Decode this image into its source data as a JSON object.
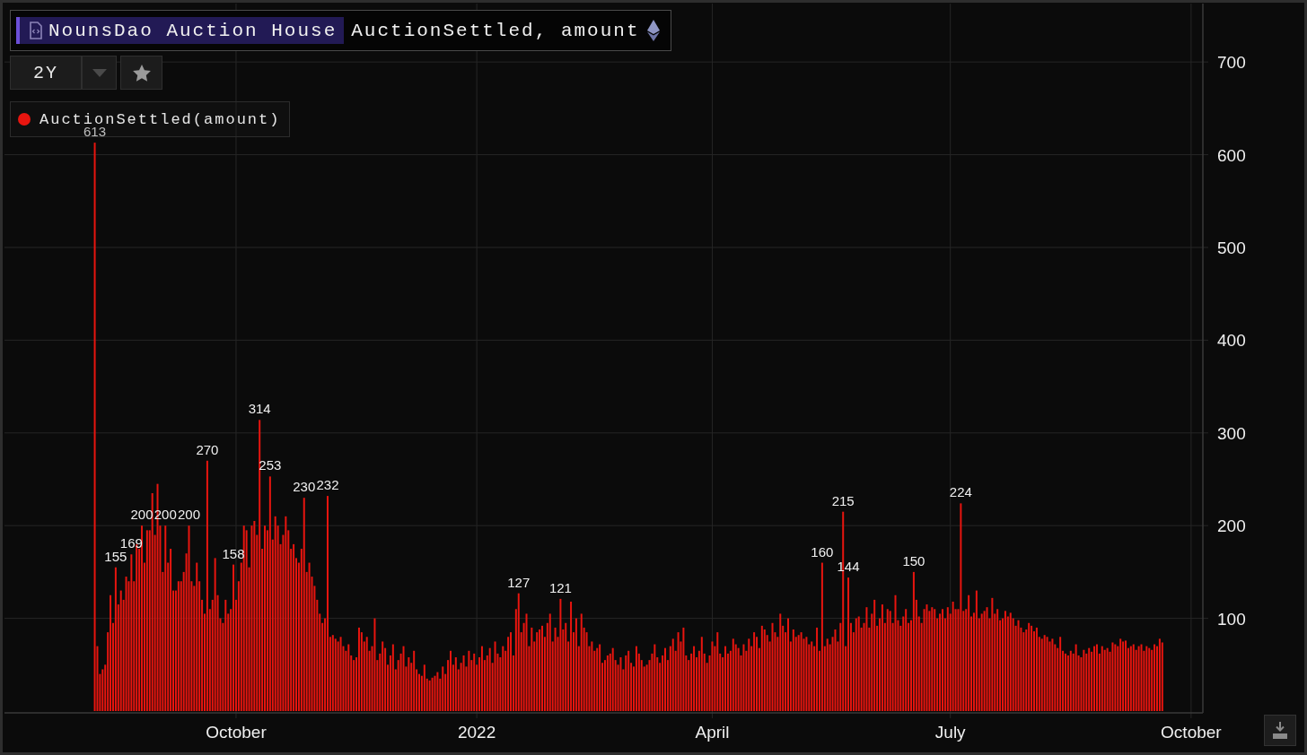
{
  "header": {
    "source": "NounsDao Auction House",
    "series_label": "AuctionSettled, amount"
  },
  "range": {
    "label": "2Y"
  },
  "chart_data": {
    "type": "bar",
    "grid": true,
    "ylim": [
      0,
      763
    ],
    "categories": [
      null,
      null,
      null,
      null,
      null,
      null,
      null,
      null,
      null,
      null,
      null,
      null,
      null,
      null,
      null,
      null,
      null,
      null,
      null,
      null,
      null,
      null,
      null,
      null,
      null,
      null,
      null,
      null,
      null,
      null,
      null,
      null,
      null,
      null,
      null,
      null,
      null,
      null,
      null,
      null,
      null,
      null,
      null,
      null,
      null,
      null,
      null,
      null,
      null,
      null,
      null,
      null,
      null,
      null,
      null,
      null,
      null,
      null,
      null,
      null,
      null,
      null,
      null,
      null,
      null,
      null,
      null,
      null,
      null,
      null,
      null,
      null,
      null,
      null,
      null,
      null,
      null,
      null,
      null,
      null,
      null,
      null,
      null,
      null,
      null,
      null,
      null,
      null,
      "October",
      null,
      null,
      null,
      null,
      null,
      null,
      null,
      null,
      null,
      null,
      null,
      null,
      null,
      null,
      null,
      null,
      null,
      null,
      null,
      null,
      null,
      null,
      null,
      null,
      null,
      null,
      null,
      null,
      null,
      null,
      null,
      null,
      null,
      null,
      null,
      null,
      null,
      null,
      null,
      null,
      null,
      null,
      null,
      null,
      null,
      null,
      null,
      null,
      null,
      null,
      null,
      null,
      null,
      null,
      null,
      null,
      null,
      null,
      null,
      null,
      null,
      null,
      null,
      null,
      null,
      null,
      null,
      null,
      null,
      null,
      null,
      null,
      null,
      null,
      null,
      null,
      null,
      null,
      null,
      null,
      null,
      null,
      null,
      null,
      null,
      null,
      null,
      null,
      null,
      null,
      null,
      "2022",
      null,
      null,
      null,
      null,
      null,
      null,
      null,
      null,
      null,
      null,
      null,
      null,
      null,
      null,
      null,
      null,
      null,
      null,
      null,
      null,
      null,
      null,
      null,
      null,
      null,
      null,
      null,
      null,
      null,
      null,
      null,
      null,
      null,
      null,
      null,
      null,
      null,
      null,
      null,
      null,
      null,
      null,
      null,
      null,
      null,
      null,
      null,
      null,
      null,
      null,
      null,
      null,
      null,
      null,
      null,
      null,
      null,
      null,
      null,
      null,
      null,
      null,
      null,
      null,
      null,
      null,
      null,
      null,
      null,
      null,
      null,
      null,
      null,
      null,
      null,
      null,
      null,
      null,
      null,
      null,
      null,
      null,
      null,
      null,
      null,
      null,
      null,
      null,
      null,
      "April",
      null,
      null,
      null,
      null,
      null,
      null,
      null,
      null,
      null,
      null,
      null,
      null,
      null,
      null,
      null,
      null,
      null,
      null,
      null,
      null,
      null,
      null,
      null,
      null,
      null,
      null,
      null,
      null,
      null,
      null,
      null,
      null,
      null,
      null,
      null,
      null,
      null,
      null,
      null,
      null,
      null,
      null,
      null,
      null,
      null,
      null,
      null,
      null,
      null,
      null,
      null,
      null,
      null,
      null,
      null,
      null,
      null,
      null,
      null,
      null,
      null,
      null,
      null,
      null,
      null,
      null,
      null,
      null,
      null,
      null,
      null,
      null,
      null,
      null,
      null,
      null,
      null,
      null,
      null,
      null,
      null,
      null,
      null,
      null,
      null,
      null,
      null,
      null,
      null,
      null,
      "July",
      null,
      null,
      null,
      null,
      null,
      null,
      null,
      null,
      null,
      null,
      null,
      null,
      null,
      null,
      null,
      null,
      null,
      null,
      null,
      null,
      null,
      null,
      null,
      null,
      null,
      null,
      null,
      null,
      null,
      null,
      null,
      null,
      null,
      null,
      null,
      null,
      null,
      null,
      null,
      null,
      null,
      null,
      null,
      null,
      null,
      null,
      null,
      null,
      null,
      null,
      null,
      null,
      null,
      null,
      null,
      null,
      null,
      null,
      null,
      null,
      null,
      null,
      null,
      null,
      null,
      null,
      null,
      null,
      null,
      null,
      null,
      null,
      null,
      null,
      null,
      null,
      null,
      null,
      null,
      null,
      null,
      null,
      null,
      null,
      null,
      null,
      null,
      null,
      null,
      null,
      null,
      "October",
      null,
      null,
      null,
      null
    ],
    "yticks": [
      100,
      200,
      300,
      400,
      500,
      600,
      700
    ],
    "series": [
      {
        "name": "AuctionSettled(amount)",
        "color": "#e8150f",
        "values": [
          null,
          null,
          null,
          null,
          null,
          null,
          null,
          null,
          null,
          null,
          null,
          null,
          null,
          null,
          null,
          null,
          null,
          null,
          null,
          null,
          null,
          null,
          null,
          null,
          null,
          null,
          null,
          null,
          null,
          null,
          null,
          null,
          null,
          null,
          613,
          70,
          40,
          45,
          50,
          85,
          125,
          95,
          155,
          115,
          130,
          120,
          145,
          140,
          169,
          140,
          180,
          175,
          200,
          160,
          195,
          195,
          235,
          190,
          245,
          200,
          150,
          200,
          160,
          175,
          130,
          130,
          140,
          140,
          150,
          170,
          200,
          140,
          135,
          160,
          140,
          120,
          105,
          270,
          110,
          120,
          165,
          125,
          100,
          95,
          120,
          105,
          110,
          158,
          120,
          140,
          160,
          200,
          195,
          155,
          200,
          205,
          190,
          314,
          175,
          200,
          195,
          253,
          185,
          210,
          200,
          180,
          190,
          210,
          195,
          175,
          180,
          165,
          160,
          175,
          230,
          150,
          160,
          145,
          135,
          120,
          105,
          95,
          100,
          232,
          80,
          82,
          78,
          75,
          80,
          70,
          65,
          72,
          60,
          55,
          58,
          90,
          85,
          75,
          80,
          65,
          70,
          100,
          55,
          62,
          75,
          68,
          50,
          60,
          72,
          45,
          55,
          62,
          70,
          48,
          58,
          52,
          65,
          45,
          40,
          38,
          50,
          35,
          33,
          36,
          38,
          42,
          35,
          48,
          40,
          55,
          65,
          50,
          58,
          45,
          52,
          60,
          48,
          65,
          55,
          62,
          50,
          58,
          70,
          55,
          60,
          68,
          52,
          75,
          62,
          58,
          70,
          65,
          80,
          85,
          60,
          110,
          127,
          85,
          95,
          105,
          70,
          90,
          75,
          85,
          88,
          92,
          80,
          95,
          105,
          75,
          90,
          80,
          121,
          88,
          95,
          75,
          118,
          85,
          100,
          70,
          105,
          90,
          85,
          70,
          75,
          65,
          68,
          72,
          52,
          55,
          60,
          62,
          68,
          55,
          50,
          58,
          45,
          60,
          65,
          52,
          48,
          70,
          62,
          55,
          48,
          50,
          55,
          62,
          72,
          58,
          52,
          60,
          68,
          55,
          70,
          78,
          65,
          85,
          75,
          90,
          60,
          55,
          62,
          70,
          58,
          65,
          80,
          62,
          52,
          60,
          75,
          70,
          85,
          62,
          58,
          70,
          62,
          65,
          78,
          72,
          68,
          60,
          72,
          65,
          78,
          70,
          85,
          80,
          68,
          92,
          88,
          82,
          75,
          95,
          85,
          80,
          105,
          92,
          85,
          100,
          75,
          88,
          80,
          82,
          85,
          78,
          80,
          72,
          75,
          70,
          90,
          65,
          160,
          70,
          78,
          72,
          80,
          88,
          75,
          95,
          215,
          70,
          144,
          95,
          85,
          100,
          102,
          90,
          95,
          112,
          90,
          105,
          120,
          92,
          100,
          115,
          95,
          110,
          108,
          95,
          125,
          98,
          92,
          102,
          110,
          95,
          98,
          150,
          120,
          102,
          95,
          110,
          115,
          108,
          112,
          110,
          100,
          105,
          110,
          100,
          112,
          105,
          118,
          110,
          110,
          224,
          108,
          110,
          125,
          102,
          106,
          130,
          100,
          105,
          108,
          112,
          100,
          122,
          105,
          110,
          98,
          100,
          108,
          102,
          106,
          100,
          92,
          98,
          90,
          85,
          88,
          95,
          92,
          86,
          90,
          80,
          78,
          82,
          80,
          75,
          78,
          72,
          68,
          80,
          65,
          62,
          60,
          65,
          62,
          72,
          60,
          58,
          66,
          62,
          68,
          64,
          70,
          72,
          62,
          70,
          66,
          68,
          64,
          74,
          72,
          70,
          78,
          75,
          76,
          68,
          70,
          72,
          66,
          70,
          72,
          65,
          70,
          68,
          66,
          72,
          70,
          78,
          74,
          null,
          null,
          null,
          null,
          null,
          null,
          null,
          null,
          null,
          null,
          null,
          null,
          null,
          null,
          null
        ]
      }
    ],
    "value_labels": [
      null,
      null,
      null,
      null,
      null,
      null,
      null,
      null,
      null,
      null,
      null,
      null,
      null,
      null,
      null,
      null,
      null,
      null,
      null,
      null,
      null,
      null,
      null,
      null,
      null,
      null,
      null,
      null,
      null,
      null,
      null,
      null,
      null,
      null,
      "613",
      null,
      null,
      null,
      null,
      null,
      null,
      null,
      "155",
      null,
      null,
      null,
      null,
      null,
      "169",
      null,
      null,
      null,
      "200",
      null,
      null,
      null,
      null,
      null,
      null,
      null,
      null,
      "200",
      null,
      null,
      null,
      null,
      null,
      null,
      null,
      null,
      "200",
      null,
      null,
      null,
      null,
      null,
      null,
      "270",
      null,
      null,
      null,
      null,
      null,
      null,
      null,
      null,
      null,
      "158",
      null,
      null,
      null,
      null,
      null,
      null,
      null,
      null,
      null,
      "314",
      null,
      null,
      null,
      "253",
      null,
      null,
      null,
      null,
      null,
      null,
      null,
      null,
      null,
      null,
      null,
      null,
      "230",
      null,
      null,
      null,
      null,
      null,
      null,
      null,
      null,
      "232",
      null,
      null,
      null,
      null,
      null,
      null,
      null,
      null,
      null,
      null,
      null,
      null,
      null,
      null,
      null,
      null,
      null,
      null,
      null,
      null,
      null,
      null,
      null,
      null,
      null,
      null,
      null,
      null,
      null,
      null,
      null,
      null,
      null,
      null,
      null,
      null,
      null,
      null,
      null,
      null,
      null,
      null,
      null,
      null,
      null,
      null,
      null,
      null,
      null,
      null,
      null,
      null,
      null,
      null,
      null,
      null,
      null,
      null,
      null,
      null,
      null,
      null,
      null,
      null,
      null,
      null,
      null,
      null,
      null,
      null,
      null,
      null,
      "127",
      null,
      null,
      null,
      null,
      null,
      null,
      null,
      null,
      null,
      null,
      null,
      null,
      null,
      null,
      null,
      "121",
      null,
      null,
      null,
      null,
      null,
      null,
      null,
      null,
      null,
      null,
      null,
      null,
      null,
      null,
      null,
      null,
      null,
      null,
      null,
      null,
      null,
      null,
      null,
      null,
      null,
      null,
      null,
      null,
      null,
      null,
      null,
      null,
      null,
      null,
      null,
      null,
      null,
      null,
      null,
      null,
      null,
      null,
      null,
      null,
      null,
      null,
      null,
      null,
      null,
      null,
      null,
      null,
      null,
      null,
      null,
      null,
      null,
      null,
      null,
      null,
      null,
      null,
      null,
      null,
      null,
      null,
      null,
      null,
      null,
      null,
      null,
      null,
      null,
      null,
      null,
      null,
      null,
      null,
      null,
      null,
      null,
      null,
      null,
      null,
      null,
      null,
      null,
      null,
      null,
      null,
      null,
      null,
      null,
      null,
      null,
      null,
      null,
      null,
      null,
      "160",
      null,
      null,
      null,
      null,
      null,
      null,
      null,
      "215",
      null,
      "144",
      null,
      null,
      null,
      null,
      null,
      null,
      null,
      null,
      null,
      null,
      null,
      null,
      null,
      null,
      null,
      null,
      null,
      null,
      null,
      null,
      null,
      null,
      null,
      null,
      "150",
      null,
      null,
      null,
      null,
      null,
      null,
      null,
      null,
      null,
      null,
      null,
      null,
      null,
      null,
      null,
      null,
      null,
      "224",
      null,
      null,
      null,
      null,
      null,
      null,
      null,
      null,
      null,
      null,
      null,
      null,
      null,
      null,
      null,
      null,
      null,
      null,
      null,
      null,
      null,
      null,
      null,
      null,
      null,
      null,
      null,
      null,
      null,
      null,
      null,
      null,
      null,
      null,
      null,
      null,
      null,
      null,
      null,
      null,
      null,
      null,
      null,
      null,
      null,
      null,
      null,
      null,
      null,
      null,
      null,
      null,
      null,
      null,
      null,
      null,
      null,
      null,
      null,
      null,
      null,
      null,
      null,
      null,
      null,
      null,
      null,
      null,
      null,
      null,
      null,
      null,
      null,
      null,
      null,
      null,
      null,
      null,
      null,
      null,
      null,
      null,
      null,
      null,
      null,
      null,
      null,
      null,
      null,
      null,
      null,
      null
    ]
  }
}
